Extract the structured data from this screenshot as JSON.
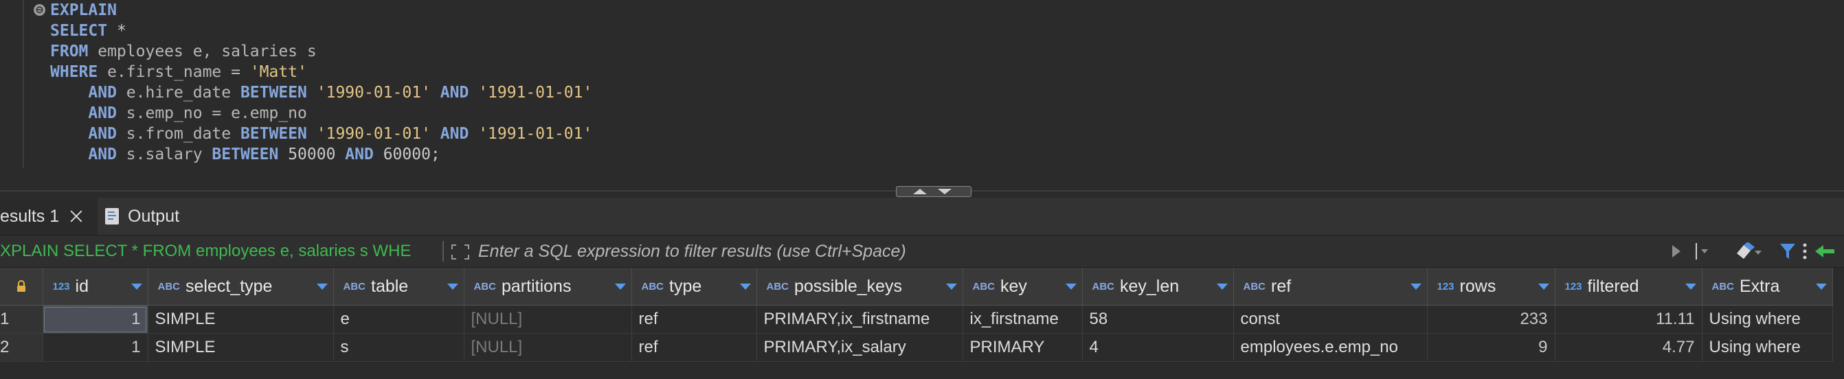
{
  "editor": {
    "fold_symbol": "⊖",
    "lines": [
      [
        {
          "t": "EXPLAIN",
          "c": "kw"
        }
      ],
      [
        {
          "t": "SELECT",
          "c": "kw"
        },
        {
          "t": " *",
          "c": "op"
        }
      ],
      [
        {
          "t": "FROM",
          "c": "kw"
        },
        {
          "t": " employees e, salaries s",
          "c": "id"
        }
      ],
      [
        {
          "t": "WHERE",
          "c": "kw"
        },
        {
          "t": " e.first_name = ",
          "c": "id"
        },
        {
          "t": "'Matt'",
          "c": "str"
        }
      ],
      [
        {
          "t": "    ",
          "c": "id"
        },
        {
          "t": "AND",
          "c": "kw"
        },
        {
          "t": " e.hire_date ",
          "c": "id"
        },
        {
          "t": "BETWEEN",
          "c": "kw"
        },
        {
          "t": " ",
          "c": "id"
        },
        {
          "t": "'1990-01-01'",
          "c": "str"
        },
        {
          "t": " ",
          "c": "id"
        },
        {
          "t": "AND",
          "c": "kw"
        },
        {
          "t": " ",
          "c": "id"
        },
        {
          "t": "'1991-01-01'",
          "c": "str"
        }
      ],
      [
        {
          "t": "    ",
          "c": "id"
        },
        {
          "t": "AND",
          "c": "kw"
        },
        {
          "t": " s.emp_no = e.emp_no",
          "c": "id"
        }
      ],
      [
        {
          "t": "    ",
          "c": "id"
        },
        {
          "t": "AND",
          "c": "kw"
        },
        {
          "t": " s.from_date ",
          "c": "id"
        },
        {
          "t": "BETWEEN",
          "c": "kw"
        },
        {
          "t": " ",
          "c": "id"
        },
        {
          "t": "'1990-01-01'",
          "c": "str"
        },
        {
          "t": " ",
          "c": "id"
        },
        {
          "t": "AND",
          "c": "kw"
        },
        {
          "t": " ",
          "c": "id"
        },
        {
          "t": "'1991-01-01'",
          "c": "str"
        }
      ],
      [
        {
          "t": "    ",
          "c": "id"
        },
        {
          "t": "AND",
          "c": "kw"
        },
        {
          "t": " s.salary ",
          "c": "id"
        },
        {
          "t": "BETWEEN",
          "c": "kw"
        },
        {
          "t": " 50000 ",
          "c": "num"
        },
        {
          "t": "AND",
          "c": "kw"
        },
        {
          "t": " 60000;",
          "c": "num"
        }
      ]
    ]
  },
  "tabs": {
    "results_label": "esults 1",
    "output_label": "Output"
  },
  "filter": {
    "query_text": "XPLAIN SELECT * FROM employees e, salaries s WHE",
    "placeholder": "Enter a SQL expression to filter results (use Ctrl+Space)"
  },
  "grid": {
    "columns": [
      {
        "type": "123",
        "name": "id"
      },
      {
        "type": "ABC",
        "name": "select_type"
      },
      {
        "type": "ABC",
        "name": "table"
      },
      {
        "type": "ABC",
        "name": "partitions"
      },
      {
        "type": "ABC",
        "name": "type"
      },
      {
        "type": "ABC",
        "name": "possible_keys"
      },
      {
        "type": "ABC",
        "name": "key"
      },
      {
        "type": "ABC",
        "name": "key_len"
      },
      {
        "type": "ABC",
        "name": "ref"
      },
      {
        "type": "123",
        "name": "rows"
      },
      {
        "type": "123",
        "name": "filtered"
      },
      {
        "type": "ABC",
        "name": "Extra"
      }
    ],
    "rows": [
      {
        "num": "1",
        "cells": [
          "1",
          "SIMPLE",
          "e",
          "[NULL]",
          "ref",
          "PRIMARY,ix_firstname",
          "ix_firstname",
          "58",
          "const",
          "233",
          "11.11",
          "Using where"
        ]
      },
      {
        "num": "2",
        "cells": [
          "1",
          "SIMPLE",
          "s",
          "[NULL]",
          "ref",
          "PRIMARY,ix_salary",
          "PRIMARY",
          "4",
          "employees.e.emp_no",
          "9",
          "4.77",
          "Using where"
        ]
      }
    ]
  },
  "colors": {
    "keyword": "#86a7dc",
    "string": "#e2c586",
    "query_green": "#3fb950",
    "type_badge": "#87a8e0",
    "sort_arrow": "#5b9ae8"
  }
}
